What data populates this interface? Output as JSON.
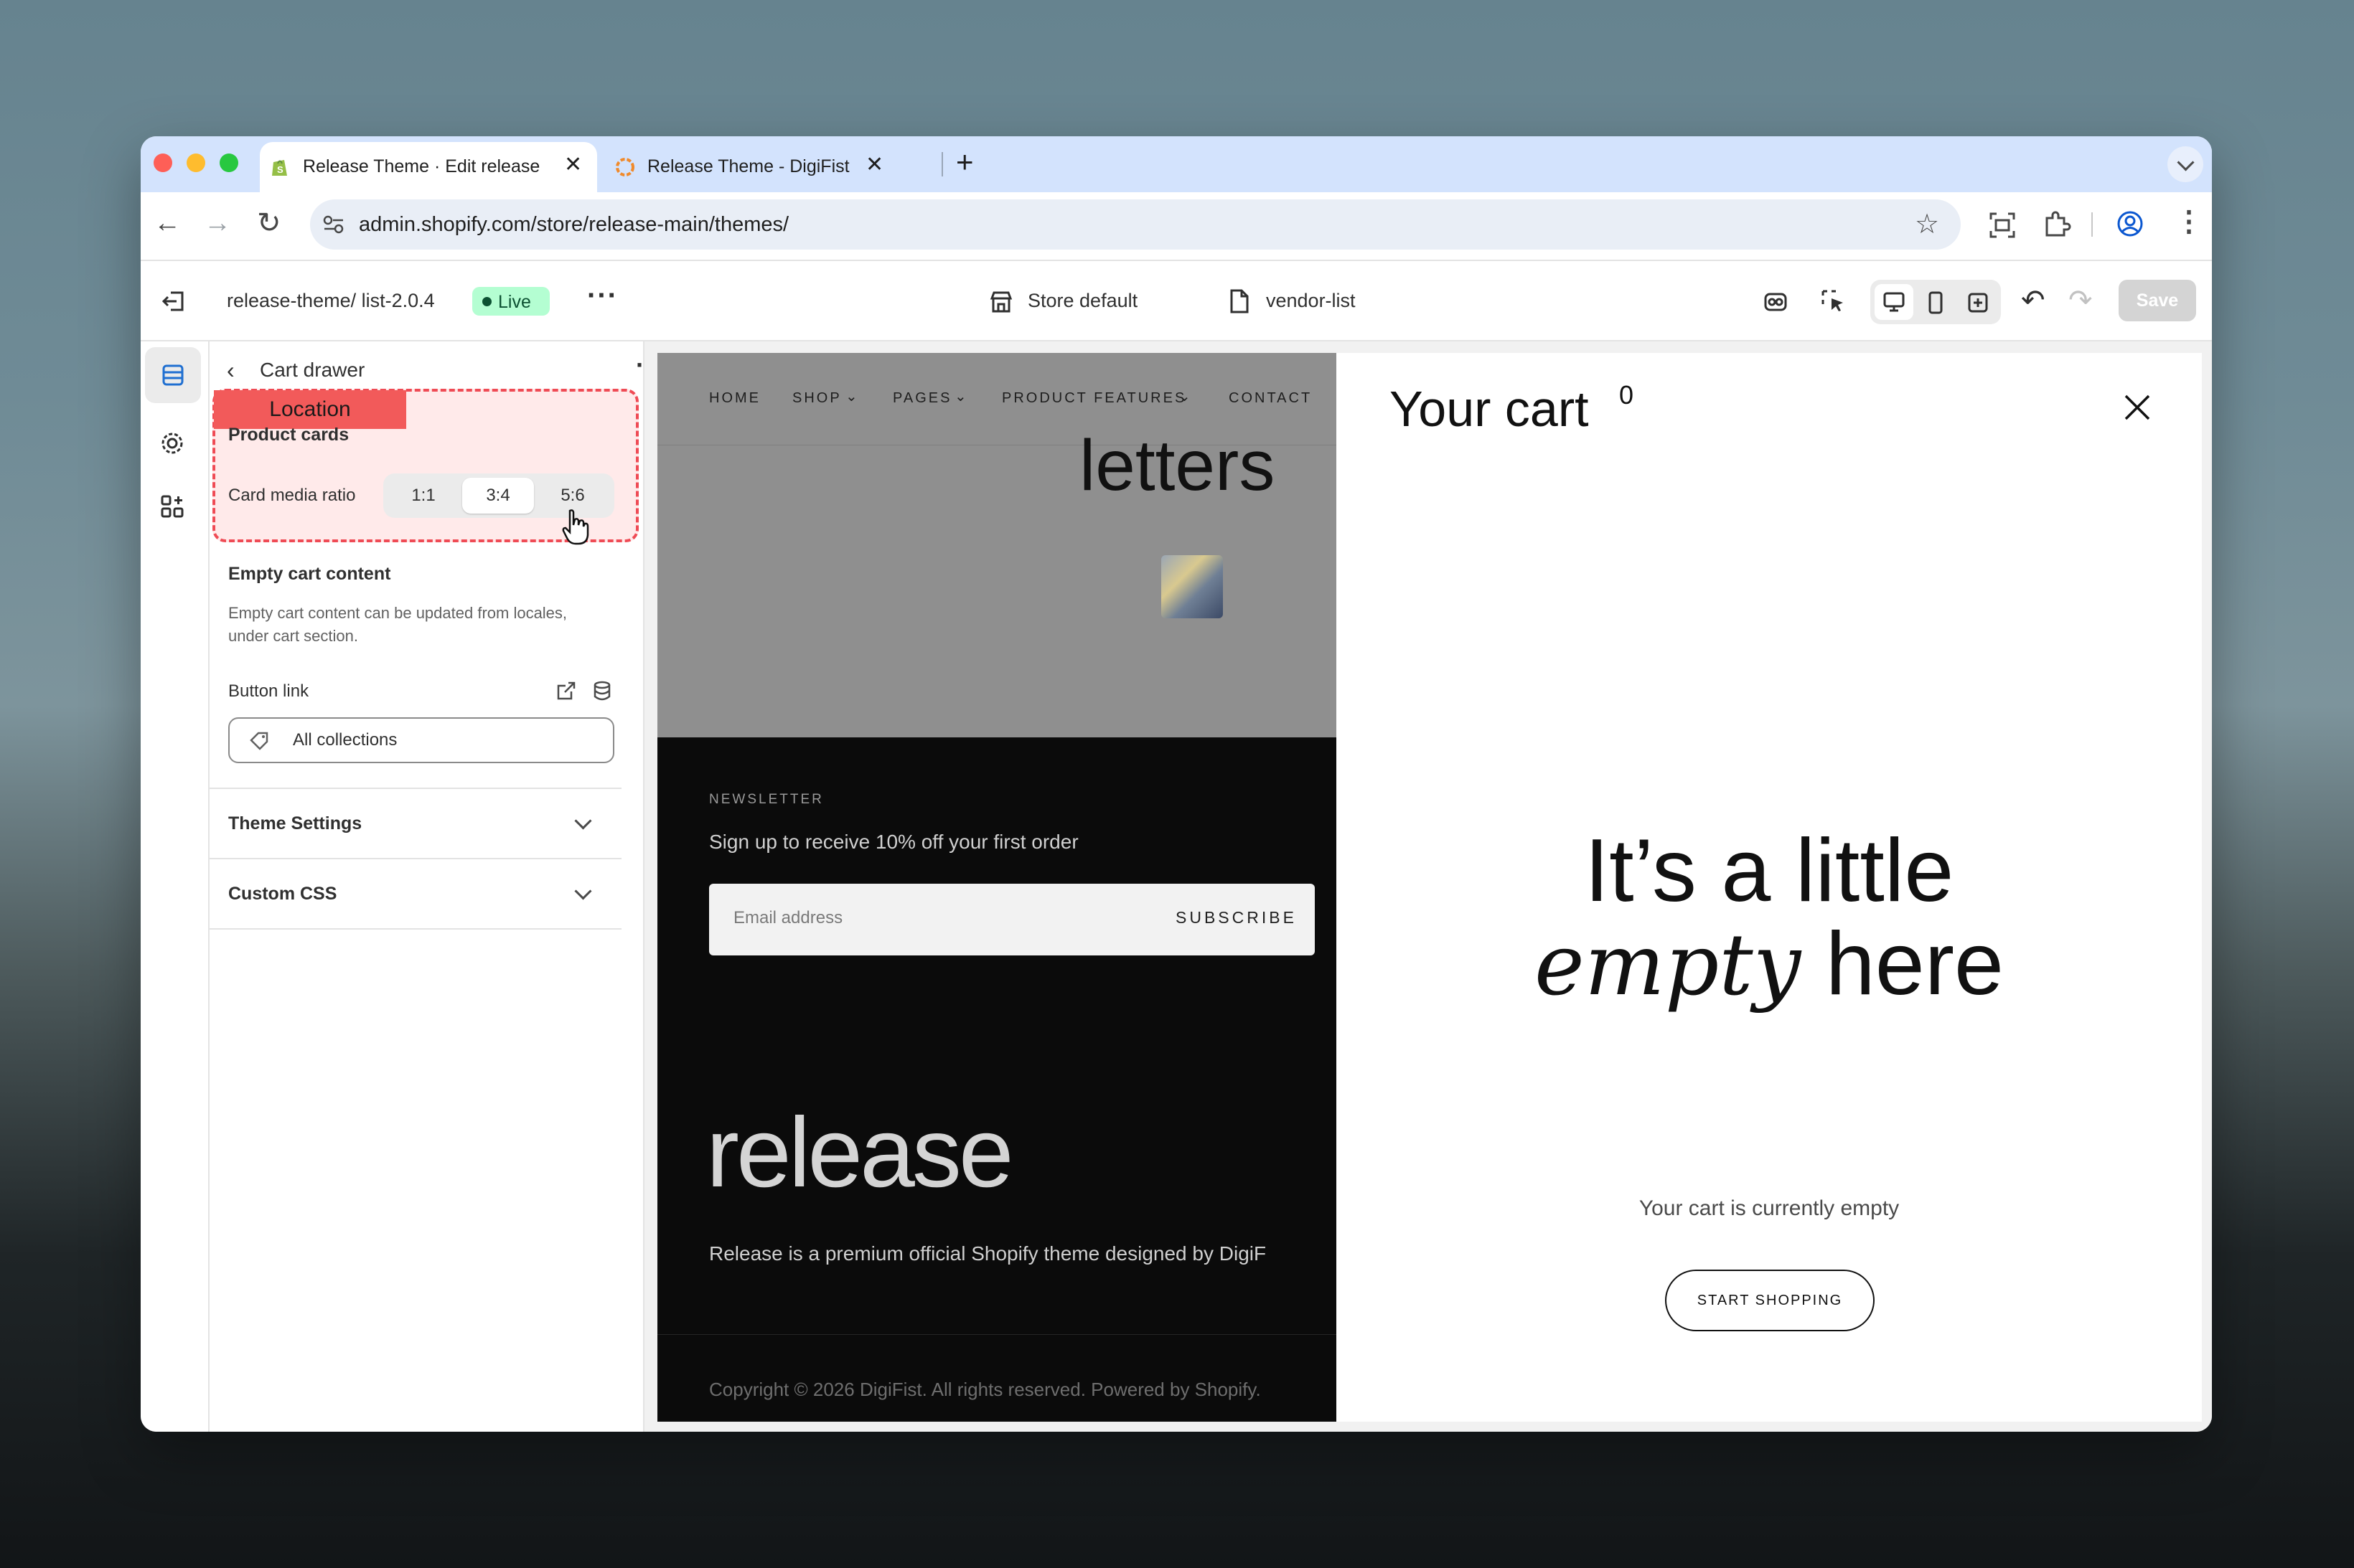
{
  "browser": {
    "tabs": [
      {
        "title": "Release Theme · Edit release",
        "active": true
      },
      {
        "title": "Release Theme - DigiFist",
        "active": false
      }
    ],
    "url": "admin.shopify.com/store/release-main/themes/"
  },
  "editor": {
    "theme_name": "release-theme/ list-2.0.4",
    "status_badge": "Live",
    "store_selector": "Store default",
    "template_selector": "vendor-list",
    "save_label": "Save"
  },
  "sidebar": {
    "title": "Cart drawer",
    "annotation_label": "Location",
    "product_cards_heading": "Product cards",
    "card_media_ratio_label": "Card media ratio",
    "ratio_options": [
      "1:1",
      "3:4",
      "5:6"
    ],
    "ratio_selected": "3:4",
    "empty_cart_heading": "Empty cart content",
    "empty_cart_help_line1": "Empty cart content can be updated from locales,",
    "empty_cart_help_line2": "under cart section.",
    "button_link_label": "Button link",
    "button_link_value": "All collections",
    "theme_settings": "Theme Settings",
    "custom_css": "Custom CSS"
  },
  "preview": {
    "nav": [
      "HOME",
      "SHOP",
      "PAGES",
      "PRODUCT FEATURES",
      "CONTACT"
    ],
    "hero_word": "letters",
    "newsletter_label": "NEWSLETTER",
    "newsletter_text": "Sign up to receive 10% off your first order",
    "email_placeholder": "Email address",
    "subscribe_label": "SUBSCRIBE",
    "brand_logo": "release",
    "brand_description": "Release is a premium official Shopify theme designed by DigiF",
    "copyright": "Copyright © 2026 DigiFist. All rights reserved. Powered by Shopify."
  },
  "cart": {
    "title": "Your cart",
    "count": "0",
    "headline_line1": "It’s a little",
    "headline_italic": "empty",
    "headline_rest": "here",
    "empty_text": "Your cart is currently empty",
    "cta": "START SHOPPING"
  }
}
